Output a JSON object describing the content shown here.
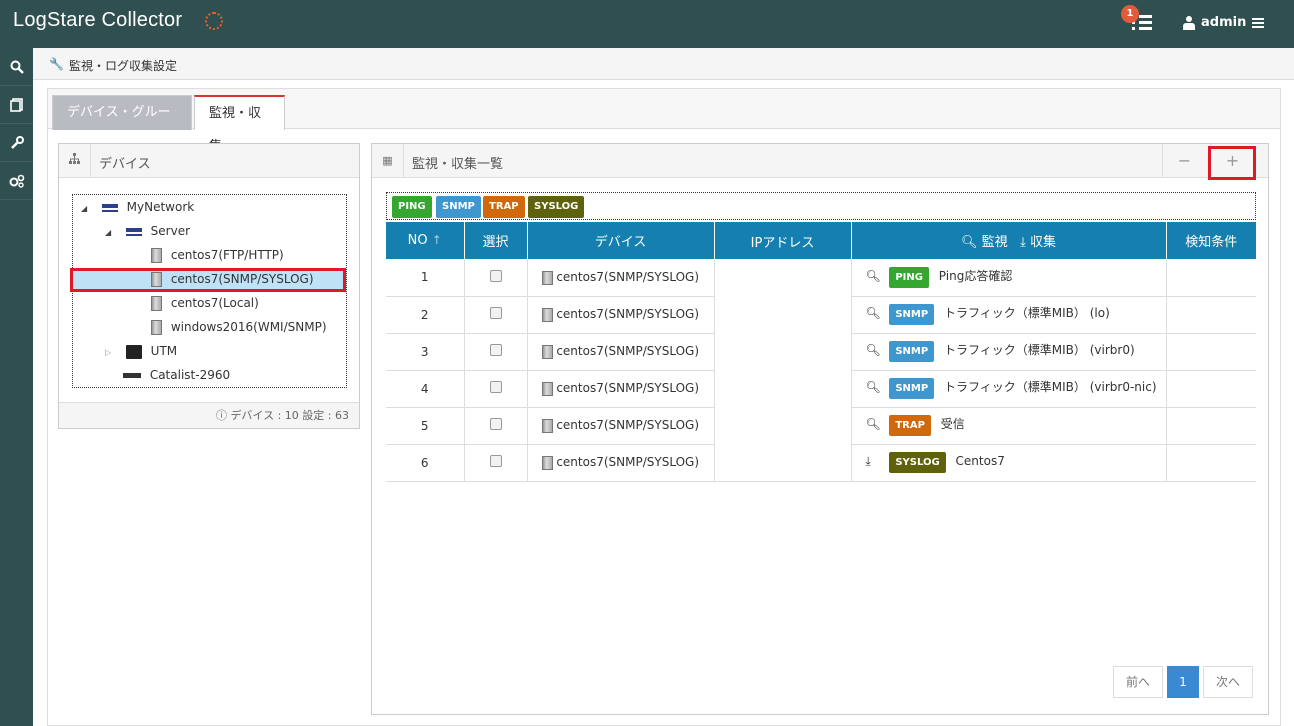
{
  "app": {
    "title": "LogStare Collector",
    "notification_count": "1",
    "user": "admin"
  },
  "breadcrumb": {
    "title": "監視・ログ収集設定"
  },
  "tabs": [
    {
      "label": "デバイス・グループ"
    },
    {
      "label": "監視・収集"
    }
  ],
  "device_panel": {
    "title": "デバイス",
    "tree": [
      {
        "label": "MyNetwork",
        "icon": "network-icon"
      },
      {
        "label": "Server",
        "icon": "network-icon"
      },
      {
        "label": "centos7(FTP/HTTP)",
        "icon": "server-icon"
      },
      {
        "label": "centos7(SNMP/SYSLOG)",
        "icon": "server-icon",
        "selected": true
      },
      {
        "label": "centos7(Local)",
        "icon": "server-icon"
      },
      {
        "label": "windows2016(WMI/SNMP)",
        "icon": "server-icon"
      },
      {
        "label": "UTM",
        "icon": "utm-icon"
      },
      {
        "label": "Catalist-2960",
        "icon": "switch-icon"
      }
    ],
    "footer": "デバイス : 10  設定 : 63"
  },
  "list_panel": {
    "title": "監視・収集一覧",
    "filters": [
      "PING",
      "SNMP",
      "TRAP",
      "SYSLOG"
    ],
    "columns": {
      "no": "NO",
      "select": "選択",
      "device": "デバイス",
      "ip": "IPアドレス",
      "monitor": "監視",
      "collect": "収集",
      "condition": "検知条件"
    },
    "rows": [
      {
        "no": "1",
        "device": "centos7(SNMP/SYSLOG)",
        "type": "PING",
        "desc": "Ping応答確認",
        "icon": "search-icon"
      },
      {
        "no": "2",
        "device": "centos7(SNMP/SYSLOG)",
        "type": "SNMP",
        "desc": "トラフィック（標準MIB） (lo)",
        "icon": "search-icon"
      },
      {
        "no": "3",
        "device": "centos7(SNMP/SYSLOG)",
        "type": "SNMP",
        "desc": "トラフィック（標準MIB） (virbr0)",
        "icon": "search-icon"
      },
      {
        "no": "4",
        "device": "centos7(SNMP/SYSLOG)",
        "type": "SNMP",
        "desc": "トラフィック（標準MIB） (virbr0-nic)",
        "icon": "search-icon"
      },
      {
        "no": "5",
        "device": "centos7(SNMP/SYSLOG)",
        "type": "TRAP",
        "desc": "受信",
        "icon": "search-icon"
      },
      {
        "no": "6",
        "device": "centos7(SNMP/SYSLOG)",
        "type": "SYSLOG",
        "desc": "Centos7",
        "icon": "download-icon"
      }
    ],
    "pager": {
      "prev": "前へ",
      "current": "1",
      "next": "次へ"
    }
  }
}
